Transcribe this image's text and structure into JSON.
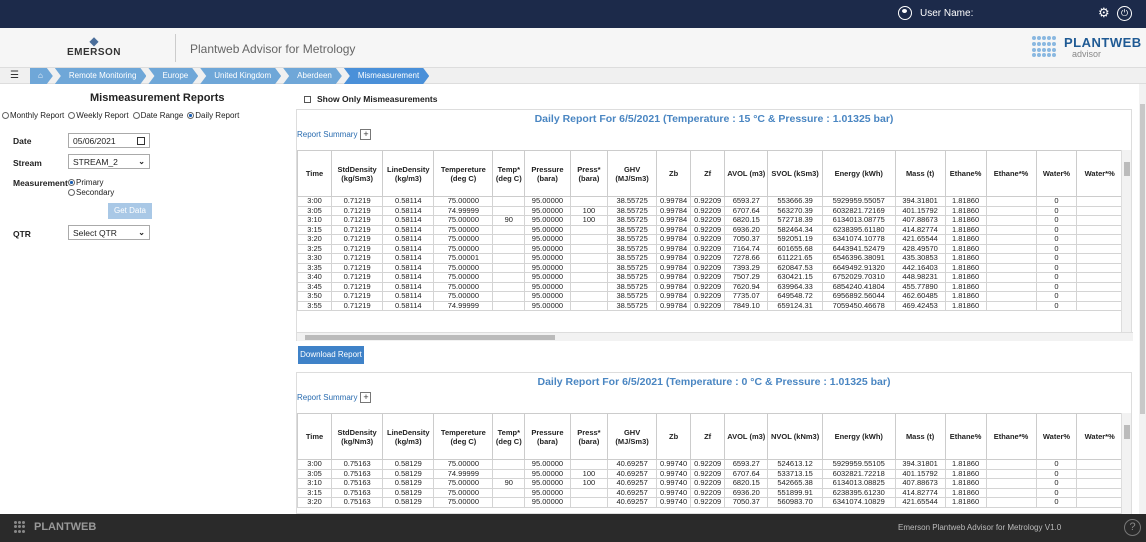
{
  "topbar": {
    "user_label": "User Name:",
    "gear_icon": "gears-icon",
    "logout_icon": "power-icon"
  },
  "header": {
    "brand": "EMERSON",
    "app_title": "Plantweb Advisor for Metrology",
    "logo_text": "PLANTWEB",
    "logo_sub": "advisor"
  },
  "breadcrumb": [
    "Remote Monitoring",
    "Europe",
    "United Kingdom",
    "Aberdeen",
    "Mismeasurement"
  ],
  "left": {
    "title": "Mismeasurement Reports",
    "report_types": [
      {
        "label": "Monthly Report",
        "selected": false
      },
      {
        "label": "Weekly Report",
        "selected": false
      },
      {
        "label": "Date Range",
        "selected": false
      },
      {
        "label": "Daily Report",
        "selected": true
      }
    ],
    "date_label": "Date",
    "date_value": "05/06/2021",
    "stream_label": "Stream",
    "stream_value": "STREAM_2",
    "measurement_label": "Measurement",
    "primary_label": "Primary",
    "secondary_label": "Secondary",
    "get_data_label": "Get Data",
    "qtr_label": "QTR",
    "qtr_value": "Select QTR"
  },
  "main": {
    "show_only_label": "Show Only Mismeasurements",
    "summary_label": "Report Summary",
    "summary_button": "+",
    "download_label": "Download Report",
    "reports": [
      {
        "title": "Daily Report For 6/5/2021 (Temperature : 15 °C & Pressure : 1.01325 bar)",
        "headers": [
          "Time",
          "StdDensity (kg/Sm3)",
          "LineDensity (kg/m3)",
          "Tempereture (deg C)",
          "Temp* (deg C)",
          "Pressure (bara)",
          "Press* (bara)",
          "GHV (MJ/Sm3)",
          "Zb",
          "Zf",
          "AVOL (m3)",
          "SVOL (kSm3)",
          "Energy (kWh)",
          "Mass (t)",
          "Ethane%",
          "Ethane*%",
          "Water%",
          "Water*%"
        ],
        "rows": [
          [
            "3:00",
            "0.71219",
            "0.58114",
            "75.00000",
            "",
            "95.00000",
            "",
            "38.55725",
            "0.99784",
            "0.92209",
            "6593.27",
            "553666.39",
            "5929959.55057",
            "394.31801",
            "1.81860",
            "",
            "0",
            ""
          ],
          [
            "3:05",
            "0.71219",
            "0.58114",
            "74.99999",
            "",
            "95.00000",
            "100",
            "38.55725",
            "0.99784",
            "0.92209",
            "6707.64",
            "563270.39",
            "6032821.72169",
            "401.15792",
            "1.81860",
            "",
            "0",
            ""
          ],
          [
            "3:10",
            "0.71219",
            "0.58114",
            "75.00000",
            "90",
            "95.00000",
            "100",
            "38.55725",
            "0.99784",
            "0.92209",
            "6820.15",
            "572718.39",
            "6134013.08775",
            "407.88673",
            "1.81860",
            "",
            "0",
            ""
          ],
          [
            "3:15",
            "0.71219",
            "0.58114",
            "75.00000",
            "",
            "95.00000",
            "",
            "38.55725",
            "0.99784",
            "0.92209",
            "6936.20",
            "582464.34",
            "6238395.61180",
            "414.82774",
            "1.81860",
            "",
            "0",
            ""
          ],
          [
            "3:20",
            "0.71219",
            "0.58114",
            "75.00000",
            "",
            "95.00000",
            "",
            "38.55725",
            "0.99784",
            "0.92209",
            "7050.37",
            "592051.19",
            "6341074.10778",
            "421.65544",
            "1.81860",
            "",
            "0",
            ""
          ],
          [
            "3:25",
            "0.71219",
            "0.58114",
            "75.00000",
            "",
            "95.00000",
            "",
            "38.55725",
            "0.99784",
            "0.92209",
            "7164.74",
            "601655.68",
            "6443941.52479",
            "428.49570",
            "1.81860",
            "",
            "0",
            ""
          ],
          [
            "3:30",
            "0.71219",
            "0.58114",
            "75.00001",
            "",
            "95.00000",
            "",
            "38.55725",
            "0.99784",
            "0.92209",
            "7278.66",
            "611221.65",
            "6546396.38091",
            "435.30853",
            "1.81860",
            "",
            "0",
            ""
          ],
          [
            "3:35",
            "0.71219",
            "0.58114",
            "75.00000",
            "",
            "95.00000",
            "",
            "38.55725",
            "0.99784",
            "0.92209",
            "7393.29",
            "620847.53",
            "6649492.91320",
            "442.16403",
            "1.81860",
            "",
            "0",
            ""
          ],
          [
            "3:40",
            "0.71219",
            "0.58114",
            "75.00000",
            "",
            "95.00000",
            "",
            "38.55725",
            "0.99784",
            "0.92209",
            "7507.29",
            "630421.15",
            "6752029.70310",
            "448.98231",
            "1.81860",
            "",
            "0",
            ""
          ],
          [
            "3:45",
            "0.71219",
            "0.58114",
            "75.00000",
            "",
            "95.00000",
            "",
            "38.55725",
            "0.99784",
            "0.92209",
            "7620.94",
            "639964.33",
            "6854240.41804",
            "455.77890",
            "1.81860",
            "",
            "0",
            ""
          ],
          [
            "3:50",
            "0.71219",
            "0.58114",
            "75.00000",
            "",
            "95.00000",
            "",
            "38.55725",
            "0.99784",
            "0.92209",
            "7735.07",
            "649548.72",
            "6956892.56044",
            "462.60485",
            "1.81860",
            "",
            "0",
            ""
          ],
          [
            "3:55",
            "0.71219",
            "0.58114",
            "74.99999",
            "",
            "95.00000",
            "",
            "38.55725",
            "0.99784",
            "0.92209",
            "7849.10",
            "659124.31",
            "7059450.46678",
            "469.42453",
            "1.81860",
            "",
            "0",
            ""
          ]
        ]
      },
      {
        "title": "Daily Report For 6/5/2021 (Temperature : 0 °C & Pressure : 1.01325 bar)",
        "headers": [
          "Time",
          "StdDensity (kg/Nm3)",
          "LineDensity (kg/m3)",
          "Tempereture (deg C)",
          "Temp* (deg C)",
          "Pressure (bara)",
          "Press* (bara)",
          "GHV (MJ/Sm3)",
          "Zb",
          "Zf",
          "AVOL (m3)",
          "NVOL (kNm3)",
          "Energy (kWh)",
          "Mass (t)",
          "Ethane%",
          "Ethane*%",
          "Water%",
          "Water*%"
        ],
        "rows": [
          [
            "3:00",
            "0.75163",
            "0.58129",
            "75.00000",
            "",
            "95.00000",
            "",
            "40.69257",
            "0.99740",
            "0.92209",
            "6593.27",
            "524613.12",
            "5929959.55105",
            "394.31801",
            "1.81860",
            "",
            "0",
            ""
          ],
          [
            "3:05",
            "0.75163",
            "0.58129",
            "74.99999",
            "",
            "95.00000",
            "100",
            "40.69257",
            "0.99740",
            "0.92209",
            "6707.64",
            "533713.15",
            "6032821.72218",
            "401.15792",
            "1.81860",
            "",
            "0",
            ""
          ],
          [
            "3:10",
            "0.75163",
            "0.58129",
            "75.00000",
            "90",
            "95.00000",
            "100",
            "40.69257",
            "0.99740",
            "0.92209",
            "6820.15",
            "542665.38",
            "6134013.08825",
            "407.88673",
            "1.81860",
            "",
            "0",
            ""
          ],
          [
            "3:15",
            "0.75163",
            "0.58129",
            "75.00000",
            "",
            "95.00000",
            "",
            "40.69257",
            "0.99740",
            "0.92209",
            "6936.20",
            "551899.91",
            "6238395.61230",
            "414.82774",
            "1.81860",
            "",
            "0",
            ""
          ],
          [
            "3:20",
            "0.75163",
            "0.58129",
            "75.00000",
            "",
            "95.00000",
            "",
            "40.69257",
            "0.99740",
            "0.92209",
            "7050.37",
            "560983.70",
            "6341074.10829",
            "421.65544",
            "1.81860",
            "",
            "0",
            ""
          ]
        ]
      }
    ]
  },
  "footer": {
    "logo_text": "PLANTWEB",
    "version": "Emerson Plantweb Advisor for Metrology V1.0",
    "help": "?"
  }
}
